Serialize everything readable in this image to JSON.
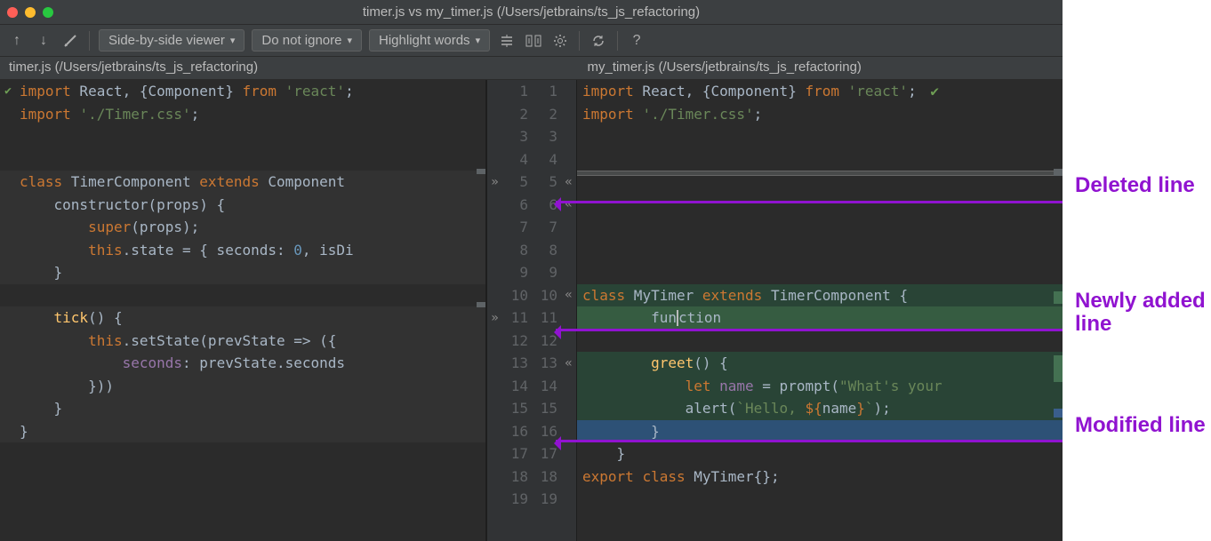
{
  "titlebar": {
    "title": "timer.js vs my_timer.js (/Users/jetbrains/ts_js_refactoring)"
  },
  "toolbar": {
    "dd_view": "Side-by-side viewer",
    "dd_ignore": "Do not ignore",
    "dd_highlight": "Highlight words",
    "icons": {
      "arrow_up": "arrow-up-icon",
      "arrow_down": "arrow-down-icon",
      "edit": "edit-icon",
      "collapse": "collapse-unchanged-icon",
      "sync_scroll": "sync-scroll-icon",
      "gear": "gear-icon",
      "refresh": "refresh-icon",
      "help": "help-icon"
    }
  },
  "file_titles": {
    "left": "timer.js (/Users/jetbrains/ts_js_refactoring)",
    "right": "my_timer.js (/Users/jetbrains/ts_js_refactoring)"
  },
  "gutter": {
    "rows": [
      {
        "left": "1",
        "right": "1",
        "chevL": "",
        "chevR": ""
      },
      {
        "left": "2",
        "right": "2",
        "chevL": "",
        "chevR": ""
      },
      {
        "left": "3",
        "right": "3",
        "chevL": "",
        "chevR": ""
      },
      {
        "left": "4",
        "right": "4",
        "chevL": "",
        "chevR": ""
      },
      {
        "left": "5",
        "right": "5",
        "chevL": "»",
        "chevR": "«"
      },
      {
        "left": "6",
        "right": "6",
        "chevL": "",
        "chevR": "«"
      },
      {
        "left": "7",
        "right": "7",
        "chevL": "",
        "chevR": ""
      },
      {
        "left": "8",
        "right": "8",
        "chevL": "",
        "chevR": ""
      },
      {
        "left": "9",
        "right": "9",
        "chevL": "",
        "chevR": ""
      },
      {
        "left": "10",
        "right": "10",
        "chevL": "",
        "chevR": "«"
      },
      {
        "left": "11",
        "right": "11",
        "chevL": "»",
        "chevR": ""
      },
      {
        "left": "12",
        "right": "12",
        "chevL": "",
        "chevR": ""
      },
      {
        "left": "13",
        "right": "13",
        "chevL": "",
        "chevR": "«"
      },
      {
        "left": "14",
        "right": "14",
        "chevL": "",
        "chevR": ""
      },
      {
        "left": "15",
        "right": "15",
        "chevL": "",
        "chevR": ""
      },
      {
        "left": "16",
        "right": "16",
        "chevL": "",
        "chevR": ""
      },
      {
        "left": "17",
        "right": "17",
        "chevL": "",
        "chevR": ""
      },
      {
        "left": "18",
        "right": "18",
        "chevL": "",
        "chevR": ""
      },
      {
        "left": "19",
        "right": "19",
        "chevL": "",
        "chevR": ""
      }
    ]
  },
  "left_code": {
    "l1": {
      "pre": "import",
      "mid": " React, {Component} ",
      "from": "from ",
      "str": "'react'",
      "end": ";"
    },
    "l2": {
      "pre": "import ",
      "str": "'./Timer.css'",
      "end": ";"
    },
    "l5": {
      "cls": "class",
      "name": " TimerComponent ",
      "ext": "extends",
      "name2": " Component "
    },
    "l6": {
      "text": "    constructor(props) {"
    },
    "l7": {
      "text": "        super(props);"
    },
    "l8": {
      "pre": "        ",
      "this": "this",
      "mid": ".state = { seconds: ",
      "num": "0",
      "end": ", isDi"
    },
    "l9": {
      "text": "    }"
    },
    "l11": {
      "text": "    tick() {"
    },
    "l12": {
      "pre": "        ",
      "this": "this",
      "mid": ".setState(prevState => ({"
    },
    "l13": {
      "text": "            seconds: prevState.seconds"
    },
    "l14": {
      "text": "        }))"
    },
    "l15": {
      "text": "    }"
    },
    "l16": {
      "text": "}"
    }
  },
  "right_code": {
    "l1": {
      "pre": "import",
      "mid": " React, {Component} ",
      "from": "from ",
      "str": "'react'",
      "end": ";"
    },
    "l2": {
      "pre": "import ",
      "str": "'./Timer.css'",
      "end": ";"
    },
    "l10": {
      "cls": "class",
      "name": " MyTimer ",
      "ext": "extends",
      "name2": " TimerComponent {"
    },
    "l11": {
      "text": "        function"
    },
    "l13": {
      "text": "        greet() {"
    },
    "l14": {
      "pre": "            ",
      "let": "let ",
      "name": "name",
      "mid": " = prompt(",
      "str": "\"What's your"
    },
    "l15": {
      "pre": "            alert(",
      "tick": "`Hello, ${",
      "expr": "name",
      "close": "}`",
      ");": ");"
    },
    "l16": {
      "text": "        }"
    },
    "l17": {
      "text": "    }"
    },
    "l18": {
      "pre": "export ",
      "cls": "class",
      "name": " MyTimer{};"
    }
  },
  "annotations": {
    "deleted": "Deleted line",
    "added": "Newly added line",
    "modified": "Modified line"
  }
}
